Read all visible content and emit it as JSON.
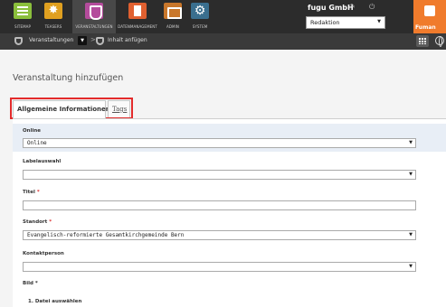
{
  "nav": {
    "items": [
      {
        "label": "SITEMAP",
        "icon": "sitemap-icon",
        "color": "#8bbf3c"
      },
      {
        "label": "TEASERS",
        "icon": "teasers-icon",
        "color": "#e0a020"
      },
      {
        "label": "VERANSTALTUNGEN",
        "icon": "events-icon",
        "color": "#b44c9c"
      },
      {
        "label": "DATENMANAGEMENT",
        "icon": "data-management-icon",
        "color": "#e06030"
      },
      {
        "label": "ADMIN",
        "icon": "admin-icon",
        "color": "#c9772b"
      },
      {
        "label": "SYSTEM",
        "icon": "system-gear-icon",
        "color": "#3a6f8f"
      }
    ],
    "active": "VERANSTALTUNGEN"
  },
  "user": {
    "company": "fugu GmbH",
    "redaktion_value": "Redaktion"
  },
  "brand": {
    "text": "Fuman",
    "color": "#f07b2c"
  },
  "breadcrumb": {
    "item1": "Veranstaltungen",
    "separator": ">",
    "item2": "Inhalt anfügen"
  },
  "page": {
    "title": "Veranstaltung hinzufügen"
  },
  "tabs": {
    "general": "Allgemeine Informationen",
    "tags": "Tags",
    "highlight_color": "#e32b2b"
  },
  "form": {
    "online": {
      "label": "Online",
      "value": "Online"
    },
    "labelauswahl": {
      "label": "Labelauswahl",
      "value": ""
    },
    "titel": {
      "label": "Titel",
      "required_mark": "*",
      "value": ""
    },
    "standort": {
      "label": "Standort",
      "required_mark": "*",
      "value": "Evangelisch-reformierte Gesamtkirchgemeinde Bern"
    },
    "kontaktperson": {
      "label": "Kontaktperson",
      "value": ""
    },
    "bild": {
      "label": "Bild",
      "required_mark": "*",
      "step1": "1. Datei auswählen"
    }
  }
}
